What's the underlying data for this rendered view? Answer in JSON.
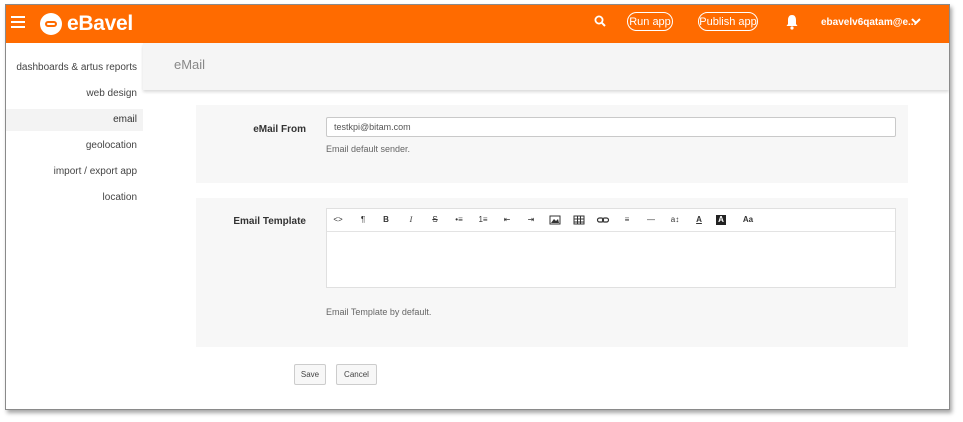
{
  "app": {
    "name": "eBavel"
  },
  "topbar": {
    "run_label": "Run app",
    "publish_label": "Publish app",
    "user_label": "ebavelv6qatam@e..."
  },
  "sidebar": {
    "items": [
      {
        "label": "dashboards & artus reports"
      },
      {
        "label": "web design"
      },
      {
        "label": "email"
      },
      {
        "label": "geolocation"
      },
      {
        "label": "import / export app"
      },
      {
        "label": "location"
      }
    ]
  },
  "page": {
    "title": "eMail"
  },
  "form": {
    "email_from": {
      "label": "eMail From",
      "value": "testkpi@bitam.com",
      "help": "Email default sender."
    },
    "email_template": {
      "label": "Email Template",
      "help": "Email Template by default.",
      "toolbar": [
        "<>",
        "¶",
        "B",
        "I",
        "S",
        "•≡",
        "1≡",
        "⇤",
        "⇥",
        "img",
        "tbl",
        "link",
        "≡",
        "—",
        "a↕",
        "A",
        "A",
        "Aa"
      ]
    }
  },
  "actions": {
    "save_label": "Save",
    "cancel_label": "Cancel"
  },
  "colors": {
    "accent": "#ff6b00"
  }
}
